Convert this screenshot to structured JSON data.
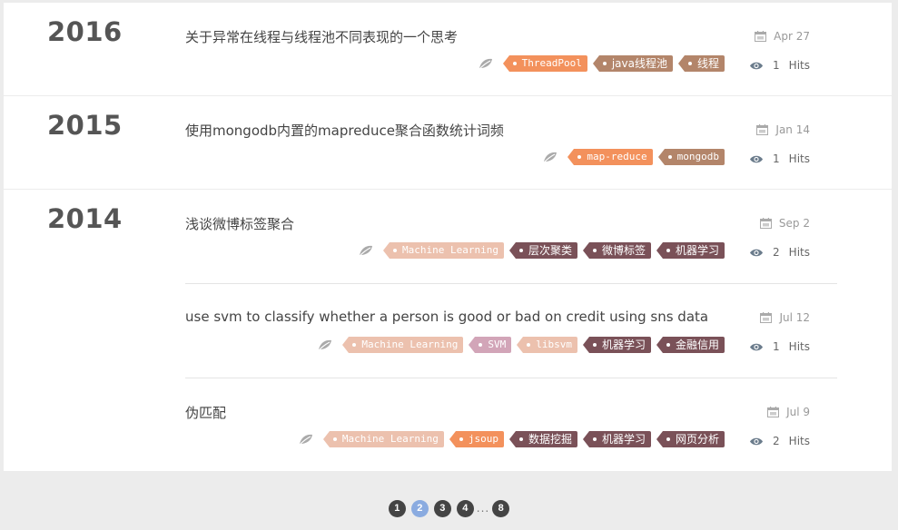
{
  "tag_colors": {
    "orange": "#f3915c",
    "tan": "#b3856a",
    "pink": "#ecc1ae",
    "mauve": "#d2a5b8",
    "plum": "#7a5158"
  },
  "hits_label": "Hits",
  "years": [
    {
      "year": "2016",
      "posts": [
        {
          "title": "关于异常在线程与线程池不同表现的一个思考",
          "date": "Apr 27",
          "hits": "1",
          "tags": [
            {
              "label": "ThreadPool",
              "color": "#f3915c"
            },
            {
              "label": "java线程池",
              "color": "#b3856a"
            },
            {
              "label": "线程",
              "color": "#b3856a"
            }
          ]
        }
      ]
    },
    {
      "year": "2015",
      "posts": [
        {
          "title": "使用mongodb内置的mapreduce聚合函数统计词频",
          "date": "Jan 14",
          "hits": "1",
          "tags": [
            {
              "label": "map-reduce",
              "color": "#f3915c"
            },
            {
              "label": "mongodb",
              "color": "#b3856a"
            }
          ]
        }
      ]
    },
    {
      "year": "2014",
      "posts": [
        {
          "title": "浅谈微博标签聚合",
          "date": "Sep 2",
          "hits": "2",
          "tags": [
            {
              "label": "Machine Learning",
              "color": "#ecc1ae"
            },
            {
              "label": "层次聚类",
              "color": "#7a5158"
            },
            {
              "label": "微博标签",
              "color": "#7a5158"
            },
            {
              "label": "机器学习",
              "color": "#7a5158"
            }
          ]
        },
        {
          "title": "use svm to classify whether a person is good or bad on credit using sns data",
          "date": "Jul 12",
          "hits": "1",
          "tags": [
            {
              "label": "Machine Learning",
              "color": "#ecc1ae"
            },
            {
              "label": "SVM",
              "color": "#d2a5b8"
            },
            {
              "label": "libsvm",
              "color": "#ecc1ae"
            },
            {
              "label": "机器学习",
              "color": "#7a5158"
            },
            {
              "label": "金融信用",
              "color": "#7a5158"
            }
          ]
        },
        {
          "title": "伪匹配",
          "date": "Jul 9",
          "hits": "2",
          "tags": [
            {
              "label": "Machine Learning",
              "color": "#ecc1ae"
            },
            {
              "label": "jsoup",
              "color": "#f3915c"
            },
            {
              "label": "数据挖掘",
              "color": "#7a5158"
            },
            {
              "label": "机器学习",
              "color": "#7a5158"
            },
            {
              "label": "网页分析",
              "color": "#7a5158"
            }
          ]
        }
      ]
    }
  ],
  "pagination": {
    "pages": [
      "1",
      "2",
      "3",
      "4"
    ],
    "current": "2",
    "ellipsis": "...",
    "last": "8"
  }
}
